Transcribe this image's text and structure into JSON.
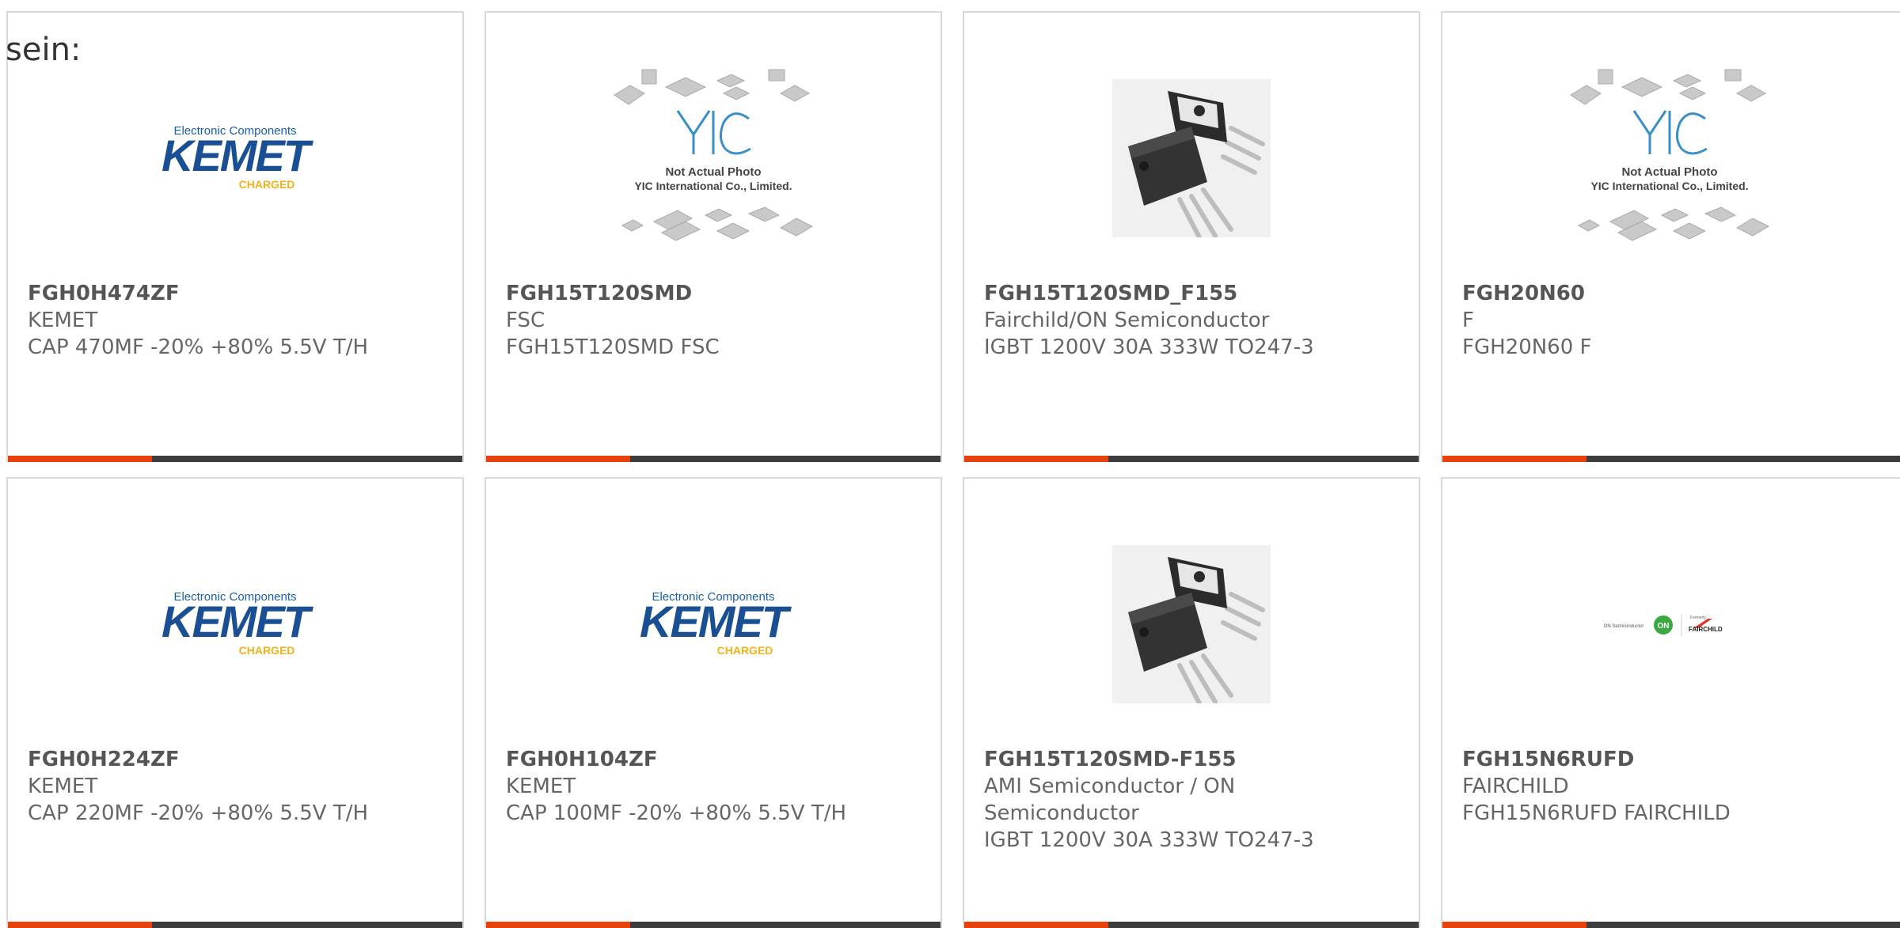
{
  "intro_text": "sein:",
  "colors": {
    "accent": "#e8420c",
    "bar": "#3d3d3d",
    "kemet_blue": "#1a5fa8",
    "kemet_gold": "#f2b21c"
  },
  "logos": {
    "kemet": {
      "tagline": "Electronic Components",
      "name": "KEMET",
      "sub": "CHARGED"
    },
    "yic": {
      "line1": "Not Actual Photo",
      "line2": "YIC International Co., Limited."
    },
    "onfair": {
      "left": "ON Semiconductor",
      "right": "FAIRCHILD",
      "small": "Formerly"
    }
  },
  "products": [
    {
      "pn": "FGH0H474ZF",
      "mfr": "KEMET",
      "desc": "CAP 470MF -20% +80% 5.5V T/H",
      "image": "kemet-logo"
    },
    {
      "pn": "FGH15T120SMD",
      "mfr": "FSC",
      "desc": "FGH15T120SMD FSC",
      "image": "yic-placeholder"
    },
    {
      "pn": "FGH15T120SMD_F155",
      "mfr": "Fairchild/ON Semiconductor",
      "desc": "IGBT 1200V 30A 333W TO247-3",
      "image": "to247-photo"
    },
    {
      "pn": "FGH20N60",
      "mfr": "F",
      "desc": "FGH20N60 F",
      "image": "yic-placeholder"
    },
    {
      "pn": "FGH0H224ZF",
      "mfr": "KEMET",
      "desc": "CAP 220MF -20% +80% 5.5V T/H",
      "image": "kemet-logo"
    },
    {
      "pn": "FGH0H104ZF",
      "mfr": "KEMET",
      "desc": "CAP 100MF -20% +80% 5.5V T/H",
      "image": "kemet-logo"
    },
    {
      "pn": "FGH15T120SMD-F155",
      "mfr": "AMI Semiconductor / ON Semiconductor",
      "desc": "IGBT 1200V 30A 333W TO247-3",
      "image": "to247-photo"
    },
    {
      "pn": "FGH15N6RUFD",
      "mfr": "FAIRCHILD",
      "desc": "FGH15N6RUFD FAIRCHILD",
      "image": "onsemi-fairchild-logo"
    }
  ]
}
